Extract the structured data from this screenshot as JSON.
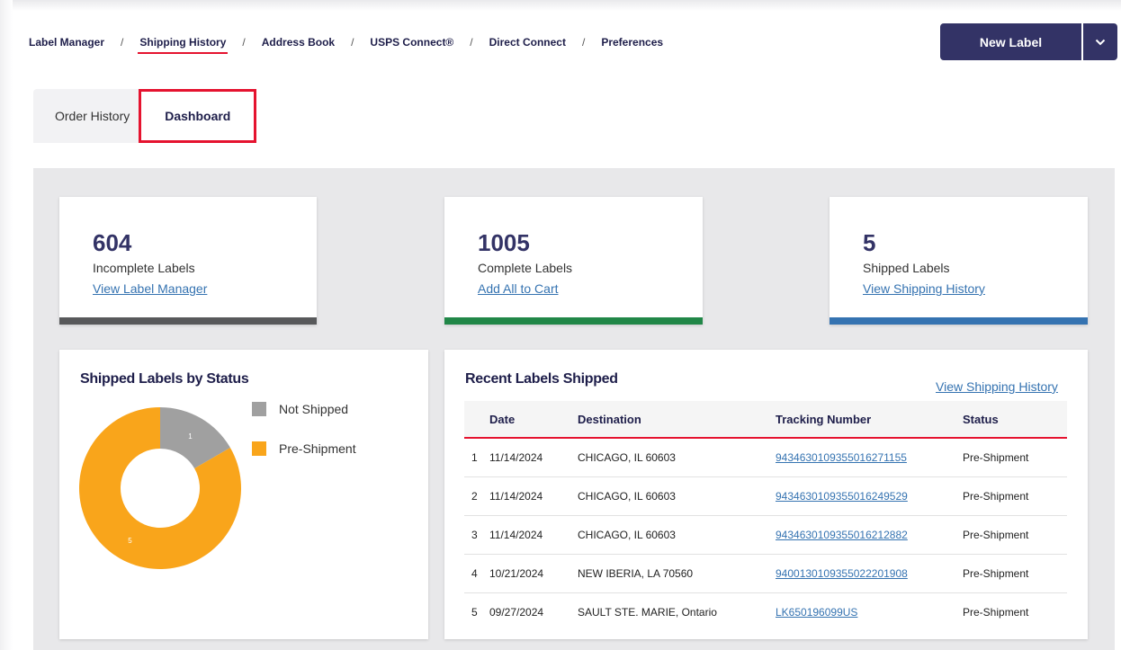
{
  "nav": {
    "items": [
      {
        "label": "Label Manager"
      },
      {
        "label": "Shipping History",
        "active": true
      },
      {
        "label": "Address Book"
      },
      {
        "label": "USPS Connect®"
      },
      {
        "label": "Direct Connect"
      },
      {
        "label": "Preferences"
      }
    ],
    "separator": "/",
    "new_label": "New Label"
  },
  "tabs": [
    {
      "label": "Order History"
    },
    {
      "label": "Dashboard",
      "active": true
    }
  ],
  "stats": [
    {
      "value": "604",
      "label": "Incomplete Labels",
      "link": "View Label Manager",
      "color": "#58595b"
    },
    {
      "value": "1005",
      "label": "Complete Labels",
      "link": "Add All to Cart",
      "color": "#218748"
    },
    {
      "value": "5",
      "label": "Shipped Labels",
      "link": "View Shipping History",
      "color": "#3573b1"
    }
  ],
  "status_chart": {
    "title": "Shipped Labels by Status",
    "legend": [
      {
        "name": "Not Shipped",
        "color": "#a0a0a0"
      },
      {
        "name": "Pre-Shipment",
        "color": "#f9a51b"
      }
    ]
  },
  "chart_data": {
    "type": "pie",
    "title": "Shipped Labels by Status",
    "categories": [
      "Not Shipped",
      "Pre-Shipment"
    ],
    "values": [
      1,
      5
    ],
    "labels": [
      "1",
      "5"
    ],
    "colors": [
      "#a0a0a0",
      "#f9a51b"
    ],
    "donut": true,
    "legend": "top-right"
  },
  "recent": {
    "title": "Recent Labels Shipped",
    "view_link": "View Shipping History",
    "columns": [
      "",
      "Date",
      "Destination",
      "Tracking Number",
      "Status"
    ],
    "rows": [
      {
        "n": "1",
        "date": "11/14/2024",
        "dest": "CHICAGO, IL 60603",
        "tracking": "9434630109355016271155",
        "status": "Pre-Shipment"
      },
      {
        "n": "2",
        "date": "11/14/2024",
        "dest": "CHICAGO, IL 60603",
        "tracking": "9434630109355016249529",
        "status": "Pre-Shipment"
      },
      {
        "n": "3",
        "date": "11/14/2024",
        "dest": "CHICAGO, IL 60603",
        "tracking": "9434630109355016212882",
        "status": "Pre-Shipment"
      },
      {
        "n": "4",
        "date": "10/21/2024",
        "dest": "NEW IBERIA, LA 70560",
        "tracking": "9400130109355022201908",
        "status": "Pre-Shipment"
      },
      {
        "n": "5",
        "date": "09/27/2024",
        "dest": "SAULT STE. MARIE, Ontario",
        "tracking": "LK650196099US",
        "status": "Pre-Shipment"
      }
    ]
  }
}
